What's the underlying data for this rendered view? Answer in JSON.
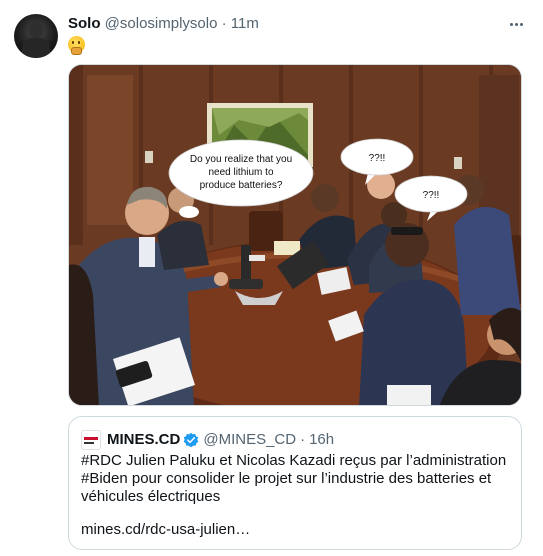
{
  "post": {
    "author_name": "Solo",
    "author_handle": "@solosimplysolo",
    "separator": "·",
    "time": "11m",
    "emoji": "🤔",
    "avatar_icon": "profile-avatar-icon",
    "more_icon": "more-options-icon"
  },
  "image": {
    "bubbles": [
      {
        "lines": [
          "Do you realize that you",
          "need lithium to",
          "produce batteries?"
        ]
      },
      {
        "lines": [
          "??!!"
        ]
      },
      {
        "lines": [
          "??!!"
        ]
      }
    ]
  },
  "quote": {
    "author_name": "MINES.CD",
    "author_handle": "@MINES_CD",
    "separator": "·",
    "time": "16h",
    "verified_icon": "verified-badge-icon",
    "verified_color": "#1d9bf0",
    "text_lines": [
      "#RDC Julien Paluku et Nicolas Kazadi reçus par l’administration",
      "#Biden pour consolider le projet sur l’industrie des batteries et",
      "véhicules électriques"
    ],
    "link": "mines.cd/rdc-usa-julien…"
  }
}
